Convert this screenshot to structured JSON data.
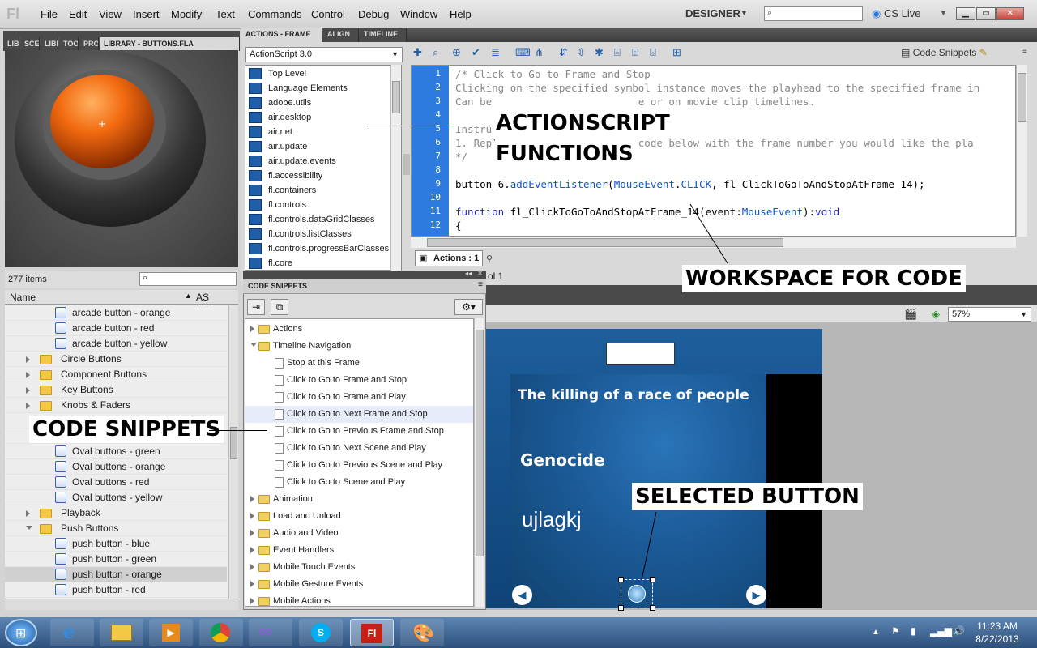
{
  "app": {
    "logo": "Fl"
  },
  "menubar": {
    "items": [
      "File",
      "Edit",
      "View",
      "Insert",
      "Modify",
      "Text",
      "Commands",
      "Control",
      "Debug",
      "Window",
      "Help"
    ],
    "workspace": "DESIGNER",
    "cs_live": "CS Live",
    "window_controls": {
      "min": "▁",
      "max": "▭",
      "close": "✕"
    }
  },
  "library": {
    "tabs": [
      "LIBI",
      "SCE",
      "LIBI",
      "TOO",
      "PRO",
      "LIBRARY - BUTTONS.FLA"
    ],
    "item_count": "277 items",
    "col_name": "Name",
    "col_linkage": "AS Linkag",
    "rows": [
      {
        "label": "arcade button - orange",
        "type": "symbol",
        "indent": 2
      },
      {
        "label": "arcade button - red",
        "type": "symbol",
        "indent": 2
      },
      {
        "label": "arcade button - yellow",
        "type": "symbol",
        "indent": 2
      },
      {
        "label": "Circle Buttons",
        "type": "folder",
        "indent": 1
      },
      {
        "label": "Component Buttons",
        "type": "folder",
        "indent": 1
      },
      {
        "label": "Key Buttons",
        "type": "folder",
        "indent": 1
      },
      {
        "label": "Knobs & Faders",
        "type": "folder",
        "indent": 1
      },
      {
        "label": "",
        "type": "hidden",
        "indent": 1
      },
      {
        "label": "",
        "type": "hidden",
        "indent": 1
      },
      {
        "label": "Oval buttons - green",
        "type": "symbol",
        "indent": 2
      },
      {
        "label": "Oval buttons - orange",
        "type": "symbol",
        "indent": 2
      },
      {
        "label": "Oval buttons - red",
        "type": "symbol",
        "indent": 2
      },
      {
        "label": "Oval buttons - yellow",
        "type": "symbol",
        "indent": 2
      },
      {
        "label": "Playback",
        "type": "folder",
        "indent": 1
      },
      {
        "label": "Push Buttons",
        "type": "folder-open",
        "indent": 1
      },
      {
        "label": "push button - blue",
        "type": "symbol",
        "indent": 2
      },
      {
        "label": "push button - green",
        "type": "symbol",
        "indent": 2
      },
      {
        "label": "push button - orange",
        "type": "symbol",
        "indent": 2,
        "selected": true
      },
      {
        "label": "push button - red",
        "type": "symbol",
        "indent": 2
      }
    ]
  },
  "actions": {
    "tabs": [
      "ACTIONS - FRAME",
      "ALIGN",
      "TIMELINE"
    ],
    "version": "ActionScript 3.0",
    "code_snippets_label": "Code Snippets",
    "toolbox": [
      "Top Level",
      "Language Elements",
      "adobe.utils",
      "air.desktop",
      "air.net",
      "air.update",
      "air.update.events",
      "fl.accessibility",
      "fl.containers",
      "fl.controls",
      "fl.controls.dataGridClasses",
      "fl.controls.listClasses",
      "fl.controls.progressBarClasses",
      "fl.core"
    ],
    "code_lines": [
      "",
      "/* Click to Go to Frame and Stop",
      "Clicking on the specified symbol instance moves the playhead to the specified frame in",
      "Can be                        e or on movie clip timelines.",
      "",
      "Instru",
      "1. Repl                       code below with the frame number you would like the pla",
      "*/",
      "",
      "button_6.addEventListener(MouseEvent.CLICK, fl_ClickToGoToAndStopAtFrame_14);",
      "",
      "function fl_ClickToGoToAndStopAtFrame_14(event:MouseEvent):void",
      "{"
    ],
    "line_numbers": [
      "1",
      "2",
      "3",
      "4",
      "5",
      "6",
      "7",
      "8",
      "9",
      "10",
      "11",
      "12"
    ],
    "frame_tab": "Actions : 1",
    "line_status": "ol 1"
  },
  "snippets": {
    "title": "CODE SNIPPETS",
    "rows": [
      {
        "label": "Actions",
        "type": "folder",
        "indent": 0
      },
      {
        "label": "Timeline Navigation",
        "type": "folder-open",
        "indent": 0
      },
      {
        "label": "Stop at this Frame",
        "type": "doc",
        "indent": 1
      },
      {
        "label": "Click to Go to Frame and Stop",
        "type": "doc",
        "indent": 1
      },
      {
        "label": "Click to Go to Frame and Play",
        "type": "doc",
        "indent": 1
      },
      {
        "label": "Click to Go to Next Frame and Stop",
        "type": "doc",
        "indent": 1,
        "selected": true
      },
      {
        "label": "Click to Go to Previous Frame and Stop",
        "type": "doc",
        "indent": 1
      },
      {
        "label": "Click to Go to Next Scene and Play",
        "type": "doc",
        "indent": 1
      },
      {
        "label": "Click to Go to Previous Scene and Play",
        "type": "doc",
        "indent": 1
      },
      {
        "label": "Click to Go to Scene and Play",
        "type": "doc",
        "indent": 1
      },
      {
        "label": "Animation",
        "type": "folder",
        "indent": 0
      },
      {
        "label": "Load and Unload",
        "type": "folder",
        "indent": 0
      },
      {
        "label": "Audio and Video",
        "type": "folder",
        "indent": 0
      },
      {
        "label": "Event Handlers",
        "type": "folder",
        "indent": 0
      },
      {
        "label": "Mobile Touch Events",
        "type": "folder",
        "indent": 0
      },
      {
        "label": "Mobile Gesture Events",
        "type": "folder",
        "indent": 0
      },
      {
        "label": "Mobile Actions",
        "type": "folder",
        "indent": 0
      }
    ]
  },
  "stage": {
    "zoom": "57%",
    "heading": "The killing of a race of people",
    "word1": "Genocide",
    "word2": "ujlagkj"
  },
  "annotations": {
    "as_line1": "ACTIONSCRIPT",
    "as_line2": "FUNCTIONS",
    "workspace": "WORKSPACE FOR CODE",
    "snippets": "CODE SNIPPETS",
    "selected": "SELECTED BUTTON"
  },
  "taskbar": {
    "time": "11:23 AM",
    "date": "8/22/2013"
  },
  "colors": {
    "accent_orange": "#f26a0f",
    "code_gutter": "#2e7be0",
    "stage_blue": "#1b5a97"
  }
}
